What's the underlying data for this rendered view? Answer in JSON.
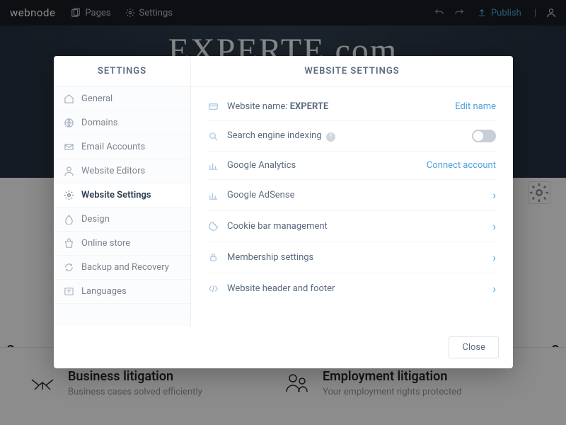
{
  "topbar": {
    "logo": "webnode",
    "pages": "Pages",
    "settings": "Settings",
    "publish": "Publish"
  },
  "hero": {
    "title": "EXPERTE.com"
  },
  "bottom": {
    "col1": {
      "heading": "Business litigation",
      "sub": "Business cases solved efficiently"
    },
    "col2": {
      "heading": "Employment litigation",
      "sub": "Your employment rights protected"
    }
  },
  "modal": {
    "sidebar_title": "SETTINGS",
    "content_title": "WEBSITE SETTINGS",
    "close": "Close"
  },
  "sidebar": {
    "items": [
      {
        "label": "General"
      },
      {
        "label": "Domains"
      },
      {
        "label": "Email Accounts"
      },
      {
        "label": "Website Editors"
      },
      {
        "label": "Website Settings"
      },
      {
        "label": "Design"
      },
      {
        "label": "Online store"
      },
      {
        "label": "Backup and Recovery"
      },
      {
        "label": "Languages"
      }
    ]
  },
  "rows": {
    "name": {
      "label": "Website name:",
      "value": "EXPERTE",
      "action": "Edit name"
    },
    "seo": {
      "label": "Search engine indexing"
    },
    "ga": {
      "label": "Google Analytics",
      "action": "Connect account"
    },
    "adsense": {
      "label": "Google AdSense"
    },
    "cookie": {
      "label": "Cookie bar management"
    },
    "membership": {
      "label": "Membership settings"
    },
    "header": {
      "label": "Website header and footer"
    }
  }
}
